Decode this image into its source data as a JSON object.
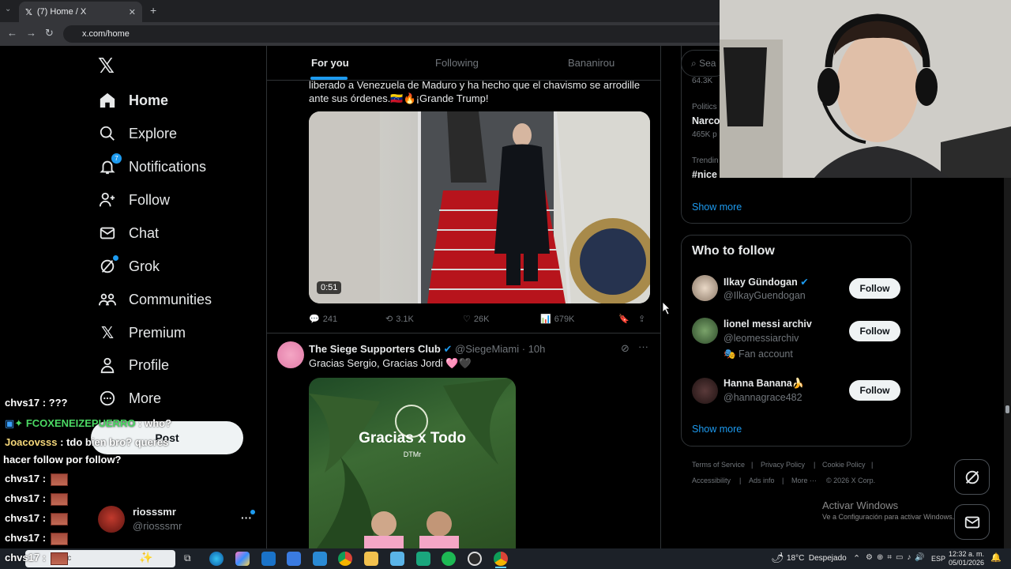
{
  "browser": {
    "tab_title": "(7) Home / X",
    "url": "x.com/home"
  },
  "sidebar": {
    "items": [
      {
        "label": "Home"
      },
      {
        "label": "Explore"
      },
      {
        "label": "Notifications",
        "badge": "7"
      },
      {
        "label": "Follow"
      },
      {
        "label": "Chat"
      },
      {
        "label": "Grok"
      },
      {
        "label": "Communities"
      },
      {
        "label": "Premium"
      },
      {
        "label": "Profile"
      },
      {
        "label": "More"
      }
    ],
    "post_button": "Post",
    "account": {
      "name": "riosssmr",
      "handle": "@riosssmr"
    }
  },
  "feed": {
    "tabs": [
      "For you",
      "Following",
      "Bananirou"
    ],
    "post1": {
      "text_line1": "liberado a Venezuela de Maduro y ha hecho que el chavismo se arrodille",
      "text_line2": "ante sus órdenes.🇻🇪🔥¡Grande Trump!",
      "video_duration": "0:51",
      "replies": "241",
      "reposts": "3.1K",
      "likes": "26K",
      "views": "679K"
    },
    "post2": {
      "author": "The Siege Supporters Club",
      "handle": "@SiegeMiami",
      "time": "· 10h",
      "text": "Gracias Sergio, Gracias Jordi 🩷🖤",
      "image_title": "Gracias x Todo",
      "image_subtitle": "DTMr"
    }
  },
  "right": {
    "search_placeholder": "Sea",
    "trends": [
      {
        "meta": "",
        "name": "",
        "count": "64.3K"
      },
      {
        "meta": "Politics",
        "name": "Narco",
        "count": "465K p"
      },
      {
        "meta": "Trendin",
        "name": "#nice",
        "count": ""
      }
    ],
    "show_more": "Show more",
    "wtf_title": "Who to follow",
    "wtf": [
      {
        "name": "Ilkay Gündogan",
        "handle": "@IlkayGuendogan",
        "extra": "",
        "follow": "Follow"
      },
      {
        "name": "lionel messi archiv",
        "handle": "@leomessiarchiv",
        "extra": "🎭 Fan account",
        "follow": "Follow"
      },
      {
        "name": "Hanna Banana🍌",
        "handle": "@hannagrace482",
        "extra": "",
        "follow": "Follow"
      }
    ],
    "wtf_show_more": "Show more",
    "footer": [
      "Terms of Service",
      "|",
      "Privacy Policy",
      "|",
      "Cookie Policy",
      "|",
      "Accessibility",
      "|",
      "Ads info",
      "|",
      "More ···",
      "© 2026 X Corp."
    ]
  },
  "chat_overlay": [
    {
      "user": "chvs17",
      "msg": ": ???"
    },
    {
      "user": "FCOXENEIZEPUERRO",
      "msg": ": who?"
    },
    {
      "user": "Joacovsss",
      "msg": ": tdo bien bro? queres"
    },
    {
      "user": "",
      "msg": "hacer follow por follow?"
    },
    {
      "user": "chvs17",
      "msg": ":"
    },
    {
      "user": "chvs17",
      "msg": ":"
    },
    {
      "user": "chvs17",
      "msg": ":"
    },
    {
      "user": "chvs17",
      "msg": ":"
    },
    {
      "user": "chvs17",
      "msg": ":"
    }
  ],
  "watermark": {
    "line1": "Activar Windows",
    "line2": "Ve a Configuración para activar Windows."
  },
  "taskbar": {
    "search_text": "Busc",
    "weather": "18°C  Despejado",
    "lang": "ESP",
    "time": "12:32 a. m.",
    "date": "05/01/2026"
  },
  "colors": {
    "accent": "#1d9bf0",
    "bg": "#000000",
    "border": "#2f3336",
    "muted": "#71767b"
  }
}
